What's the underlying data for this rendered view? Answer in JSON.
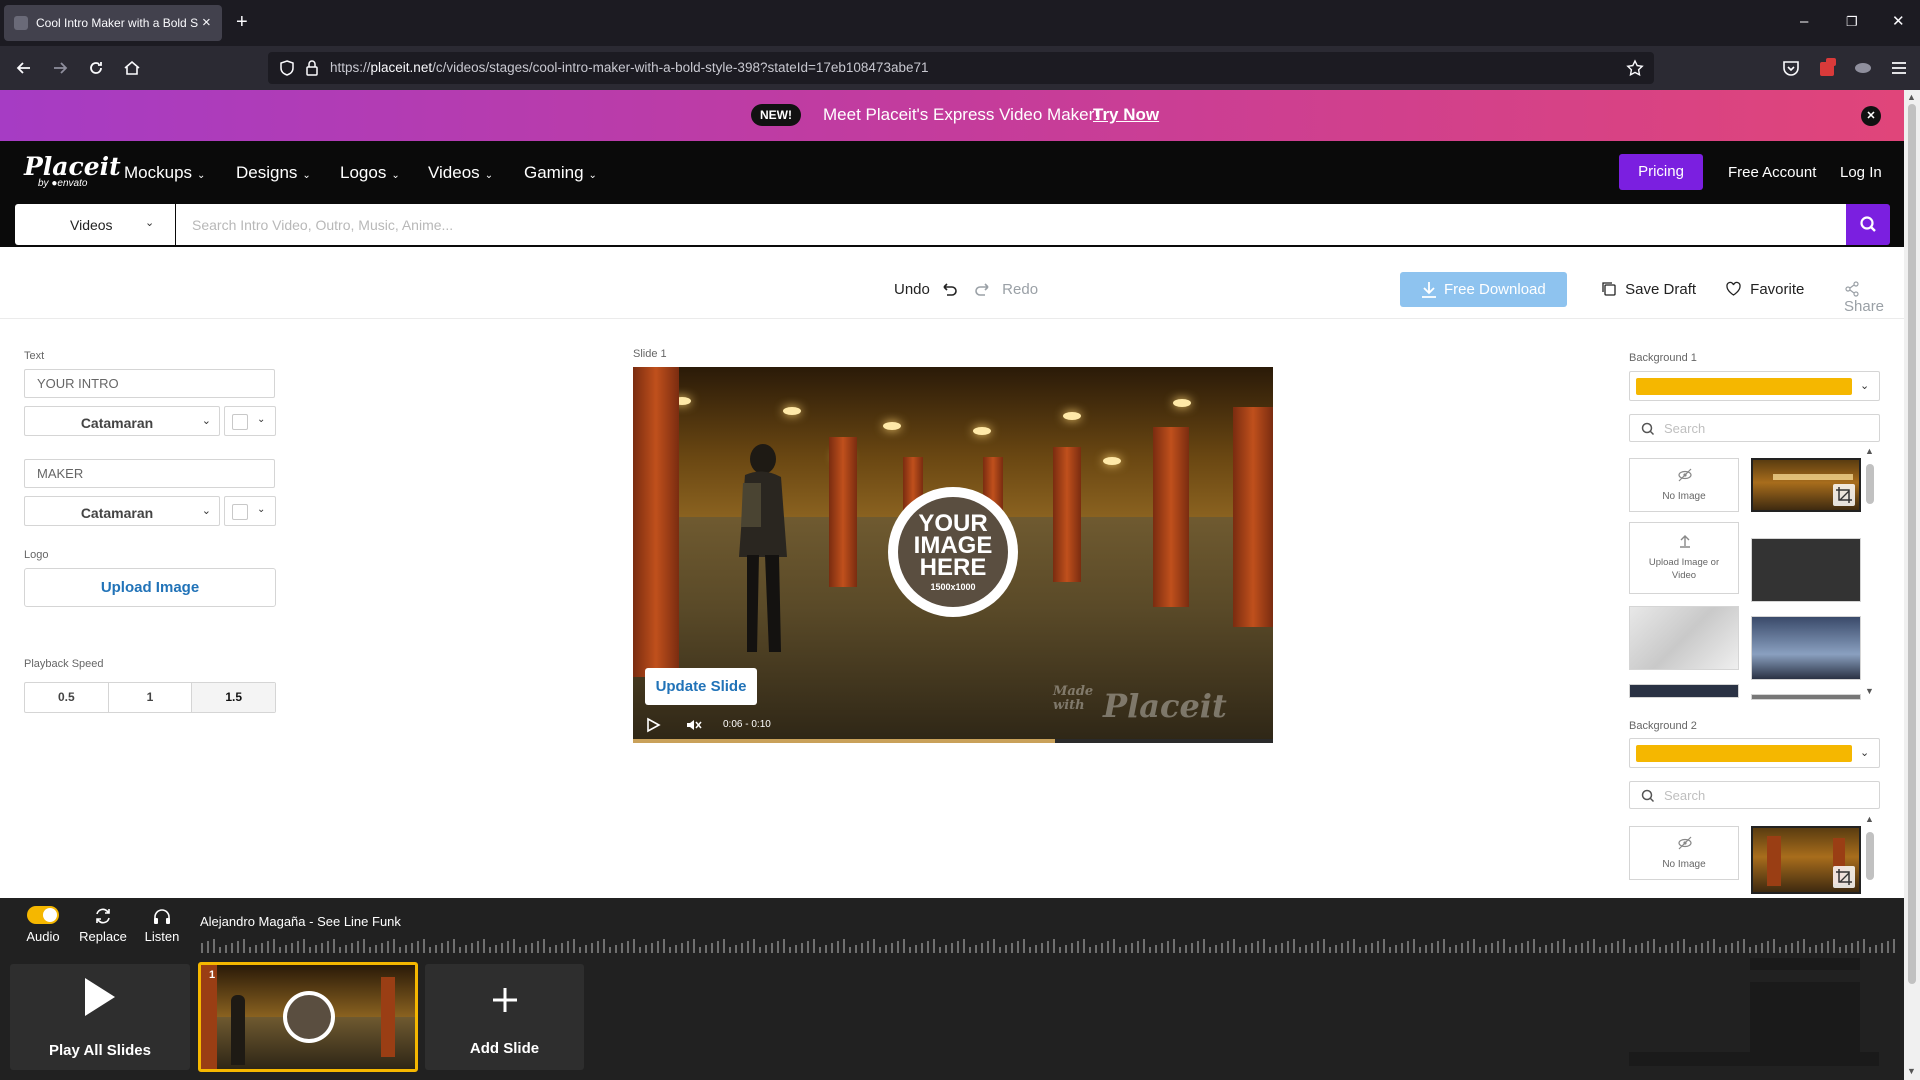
{
  "browser": {
    "tab_title": "Cool Intro Maker with a Bold St",
    "tab_close": "×",
    "new_tab": "+",
    "url_prefix": "https://",
    "url_domain": "placeit.net",
    "url_path": "/c/videos/stages/cool-intro-maker-with-a-bold-style-398?stateId=17eb108473abe71",
    "window_controls": [
      "–",
      "❐",
      "✕"
    ]
  },
  "promo": {
    "badge": "NEW!",
    "text": "Meet Placeit's Express Video Maker!",
    "link": "Try Now",
    "close": "✕"
  },
  "header": {
    "logo_main": "Placeit",
    "logo_sub": "by ●envato",
    "nav": [
      "Mockups",
      "Designs",
      "Logos",
      "Videos",
      "Gaming"
    ],
    "chevron": "⌄",
    "pricing": "Pricing",
    "free_account": "Free Account",
    "login": "Log In"
  },
  "search": {
    "category": "Videos",
    "chevron": "⌄",
    "placeholder": "Search Intro Video, Outro, Music, Anime..."
  },
  "toolbar": {
    "undo": "Undo",
    "redo": "Redo",
    "free_download": "Free Download",
    "save_draft": "Save Draft",
    "favorite": "Favorite",
    "share": "Share"
  },
  "left_panel": {
    "text_label": "Text",
    "text1_value": "YOUR INTRO",
    "text2_value": "MAKER",
    "font1": "Catamaran",
    "font2": "Catamaran",
    "chevron": "⌄",
    "logo_label": "Logo",
    "upload_image": "Upload Image",
    "playback_label": "Playback Speed",
    "speeds": [
      "0.5",
      "1",
      "1.5"
    ],
    "selected_speed": "1.5"
  },
  "preview": {
    "slide_label": "Slide 1",
    "logo_line1": "YOUR",
    "logo_line2": "IMAGE",
    "logo_line3": "HERE",
    "logo_line4": "1500x1000",
    "watermark_small": "Made with",
    "watermark_big": "Placeit",
    "update_slide": "Update Slide",
    "time": "0:06 - 0:10",
    "progress": 0.66
  },
  "right_panel": {
    "bg1_label": "Background 1",
    "bg2_label": "Background 2",
    "bg_color": "#f5b700",
    "search_placeholder": "Search",
    "no_image": "No Image",
    "upload_image_or_video": "Upload Image or Video"
  },
  "audio": {
    "audio_label": "Audio",
    "replace_label": "Replace",
    "listen_label": "Listen",
    "track": "Alejandro Magaña - See Line Funk",
    "play_all": "Play All Slides",
    "slide_number": "1",
    "add_slide": "Add Slide"
  },
  "colors": {
    "accent_purple": "#7b1fe0",
    "accent_yellow": "#f5b700",
    "link_blue": "#2173b8"
  }
}
